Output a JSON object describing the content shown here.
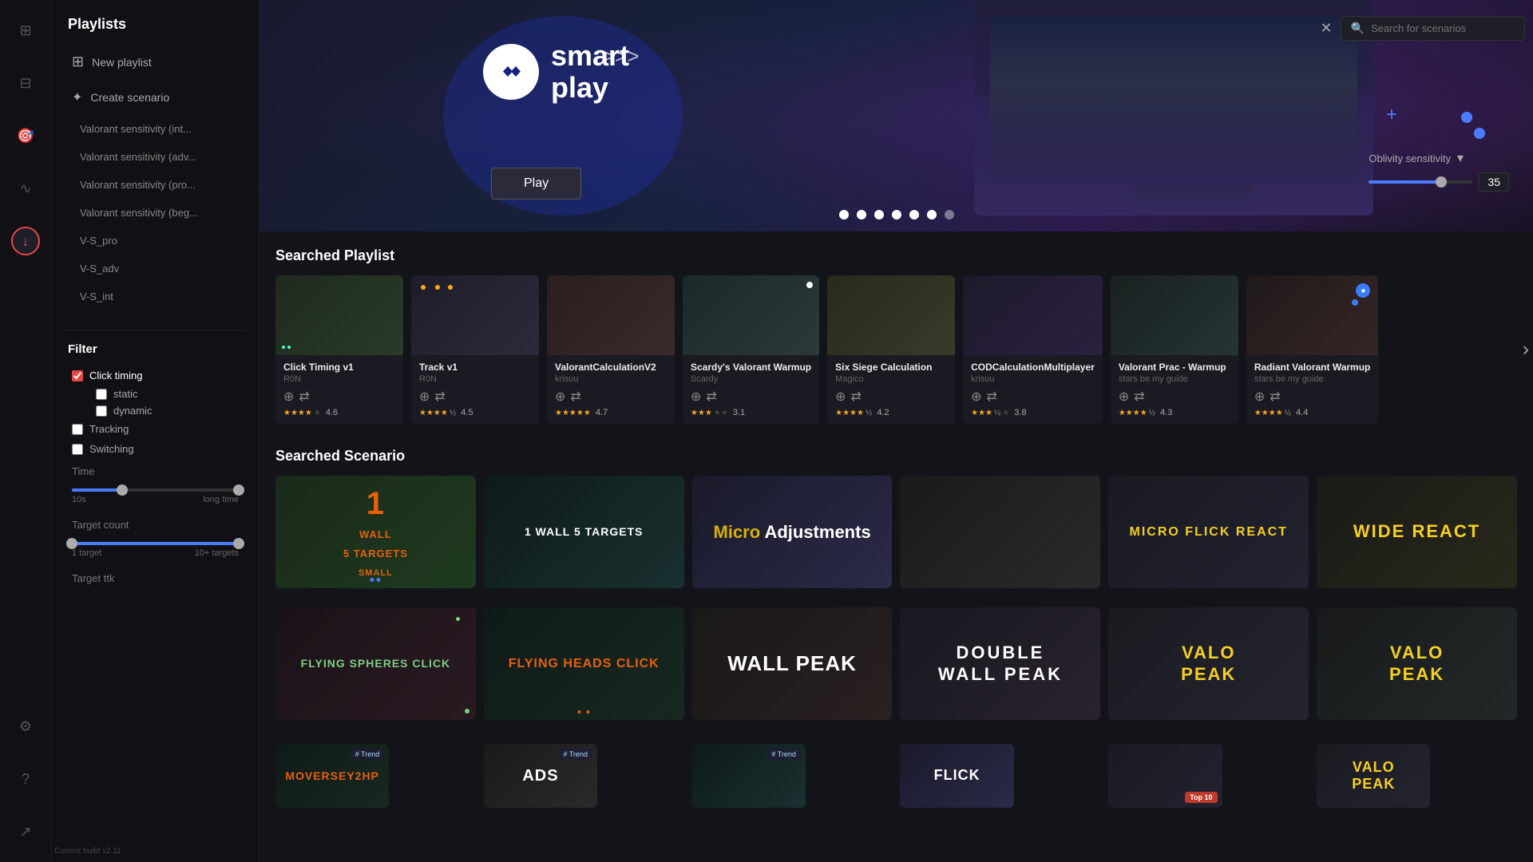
{
  "app": {
    "version": "Current build v2.11"
  },
  "iconBar": {
    "icons": [
      {
        "name": "home-icon",
        "symbol": "⊞",
        "active": false
      },
      {
        "name": "layout-icon",
        "symbol": "⊟",
        "active": false
      },
      {
        "name": "target-icon",
        "symbol": "⊕",
        "active": false
      },
      {
        "name": "chart-icon",
        "symbol": "∿",
        "active": false
      },
      {
        "name": "download-icon",
        "symbol": "↓",
        "active": true
      },
      {
        "name": "settings-icon",
        "symbol": "⚙",
        "active": false
      },
      {
        "name": "help-icon",
        "symbol": "?",
        "active": false
      },
      {
        "name": "export-icon",
        "symbol": "↗",
        "active": false
      }
    ]
  },
  "sidebar": {
    "title": "Playlists",
    "newPlaylist": "New playlist",
    "createScenario": "Create scenario",
    "playlists": [
      "Valorant sensitivity (int...",
      "Valorant sensitivity (adv...",
      "Valorant sensitivity (pro...",
      "Valorant sensitivity (beg...",
      "V-S_pro",
      "V-S_adv",
      "V-S_int"
    ],
    "filter": {
      "title": "Filter",
      "items": [
        {
          "label": "Click timing",
          "checked": true
        },
        {
          "label": "static",
          "checked": false,
          "sub": true
        },
        {
          "label": "dynamic",
          "checked": false,
          "sub": true
        },
        {
          "label": "Tracking",
          "checked": false
        },
        {
          "label": "Switching",
          "checked": false
        }
      ],
      "timeLabel": "Time",
      "timeMin": "10s",
      "timeMax": "long time",
      "targetCountLabel": "Target count",
      "targetCountMin": "1 target",
      "targetCountMax": "10+ targets",
      "targetTtkLabel": "Target ttk"
    }
  },
  "banner": {
    "smartPlay": "smart\nplay",
    "arrows": ">>>",
    "playBtn": "Play",
    "searchPlaceholder": "Search for scenarios",
    "oblivity": {
      "label": "Oblivity sensitivity",
      "value": "35"
    },
    "dots": 7
  },
  "searchedPlaylist": {
    "title": "Searched Playlist",
    "cards": [
      {
        "name": "Click Timing v1",
        "author": "R0N",
        "rating": 4.6,
        "stars": 5,
        "halfStar": false,
        "bg": "pct-1"
      },
      {
        "name": "Track v1",
        "author": "R0N",
        "rating": 4.5,
        "stars": 4,
        "halfStar": true,
        "bg": "pct-2"
      },
      {
        "name": "ValorantCalculationV2",
        "author": "krisuu",
        "rating": 4.7,
        "stars": 5,
        "halfStar": false,
        "bg": "pct-3"
      },
      {
        "name": "Scardy's Valorant Warmup",
        "author": "Scardy",
        "rating": 3.1,
        "stars": 3,
        "halfStar": false,
        "bg": "pct-4"
      },
      {
        "name": "Six Siege Calculation",
        "author": "Magico",
        "rating": 4.2,
        "stars": 4,
        "halfStar": true,
        "bg": "pct-5"
      },
      {
        "name": "CODCalculationMultiplayer",
        "author": "krisuu",
        "rating": 3.8,
        "stars": 3,
        "halfStar": true,
        "bg": "pct-6"
      },
      {
        "name": "Valorant Prac - Warmup",
        "author": "stars be my guide",
        "rating": 4.3,
        "stars": 4,
        "halfStar": true,
        "bg": "pct-7"
      },
      {
        "name": "Radiant Valorant Warmup",
        "author": "stars be my guide",
        "rating": 4.4,
        "stars": 4,
        "halfStar": true,
        "bg": "pct-8"
      }
    ]
  },
  "searchedScenario": {
    "title": "Searched Scenario",
    "scenarios": [
      {
        "label": "1\nwall\n5 targets\nsmall",
        "labelClass": "label-orange",
        "bg": "sc-1"
      },
      {
        "label": "1 WALL 5 TARGETS",
        "labelClass": "label-white",
        "bg": "sc-2"
      },
      {
        "label": "Micro Adjustments",
        "labelClass": "label-yellow",
        "bg": "sc-3"
      },
      {
        "label": "",
        "labelClass": "",
        "bg": "sc-4"
      },
      {
        "label": "MICRO FLICK REACT",
        "labelClass": "label-yellow",
        "bg": "sc-5"
      },
      {
        "label": "WIDE REACT",
        "labelClass": "label-yellow",
        "bg": "sc-6"
      },
      {
        "label": "flying Spheres click",
        "labelClass": "label-green",
        "bg": "sc-7"
      },
      {
        "label": "FLYING HEADS CLICK",
        "labelClass": "label-orange",
        "bg": "sc-8"
      },
      {
        "label": "Wall Peak",
        "labelClass": "label-white",
        "bg": "sc-9"
      },
      {
        "label": "DOUBLE\nWALL PEAK",
        "labelClass": "label-white",
        "bg": "sc-10"
      },
      {
        "label": "VALO\nPEAK",
        "labelClass": "label-yellow",
        "bg": "sc-11"
      },
      {
        "label": "VALO\nPEAK",
        "labelClass": "label-yellow",
        "bg": "sc-12"
      }
    ],
    "row3": [
      {
        "label": "MOVERSEY2HP",
        "labelClass": "label-orange",
        "bg": "sc-8",
        "trend": "# Trend"
      },
      {
        "label": "ADS",
        "labelClass": "label-white",
        "bg": "sc-4",
        "trend": "# Trend"
      },
      {
        "label": "",
        "labelClass": "",
        "bg": "sc-2",
        "trend": "# Trend"
      },
      {
        "label": "FLICK",
        "labelClass": "label-white",
        "bg": "sc-3",
        "trend": ""
      },
      {
        "label": "",
        "labelClass": "",
        "bg": "sc-5",
        "top10": "Top 10"
      },
      {
        "label": "VALO\nPEAK",
        "labelClass": "label-yellow",
        "bg": "sc-11",
        "trend": ""
      }
    ]
  }
}
